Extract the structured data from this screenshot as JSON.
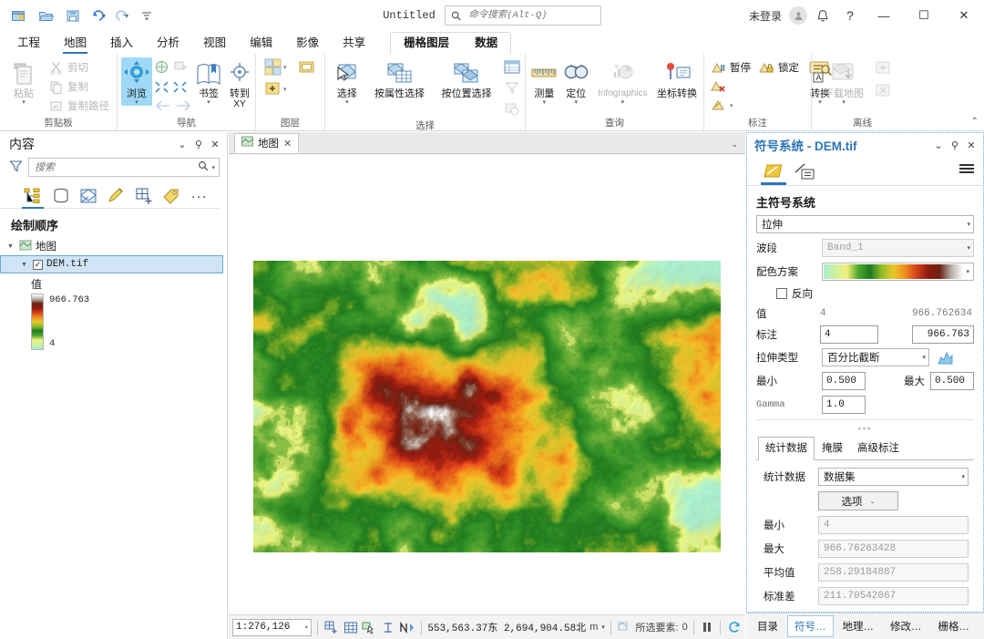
{
  "titlebar": {
    "quick_access": [
      "new-project-icon",
      "open-project-icon",
      "save-project-icon",
      "undo-icon",
      "redo-icon",
      "customize-qat-icon"
    ],
    "document_title": "Untitled",
    "search_placeholder": "命令搜索(Alt-Q)",
    "search_value": "",
    "sign_in": "未登录",
    "account_icon": "user-icon",
    "notification_icon": "bell-icon",
    "help_icon": "question-icon",
    "minimize": "—",
    "maximize": "☐",
    "close": "✕"
  },
  "ribbon": {
    "tabs": [
      {
        "label": "工程",
        "active": false
      },
      {
        "label": "地图",
        "active": true
      },
      {
        "label": "插入",
        "active": false
      },
      {
        "label": "分析",
        "active": false
      },
      {
        "label": "视图",
        "active": false
      },
      {
        "label": "编辑",
        "active": false
      },
      {
        "label": "影像",
        "active": false
      },
      {
        "label": "共享",
        "active": false
      }
    ],
    "contextual_tabs": [
      {
        "label": "栅格图层",
        "active": true
      },
      {
        "label": "数据",
        "active": false
      }
    ],
    "groups": [
      {
        "name": "剪贴板",
        "label": "剪贴板",
        "big": [
          {
            "label": "粘贴",
            "icon": "paste-icon",
            "dropdown": true,
            "disabled": false
          }
        ],
        "small": [
          {
            "label": "剪切",
            "icon": "cut-icon",
            "disabled": true
          },
          {
            "label": "复制",
            "icon": "copy-icon",
            "disabled": true
          },
          {
            "label": "复制路径",
            "icon": "copy-path-icon",
            "disabled": true
          }
        ]
      },
      {
        "name": "导航",
        "label": "导航",
        "big": [
          {
            "label": "浏览",
            "icon": "explore-icon",
            "dropdown": true,
            "active": true
          },
          {
            "label": "书签",
            "icon": "bookmarks-icon",
            "dropdown": true
          },
          {
            "label": "转到",
            "label2": "XY",
            "icon": "goto-xy-icon",
            "dropdown": false
          }
        ],
        "launcher": true
      },
      {
        "name": "图层",
        "label": "图层",
        "icons": [
          "basemap-icon",
          "add-data-icon",
          "add-layer-icon"
        ]
      },
      {
        "name": "选择",
        "label": "选择",
        "big": [
          {
            "label": "选择",
            "icon": "select-icon",
            "dropdown": true
          },
          {
            "label": "按属性选择",
            "icon": "select-by-attributes-icon",
            "dropdown": false
          },
          {
            "label": "按位置选择",
            "icon": "select-by-location-icon",
            "dropdown": false
          }
        ],
        "icons": [
          "attribute-table-icon",
          "select-layer-icon",
          "zoom-to-selection-icon"
        ],
        "launcher": true
      },
      {
        "name": "查询",
        "label": "查询",
        "big": [
          {
            "label": "测量",
            "icon": "measure-icon",
            "dropdown": true
          },
          {
            "label": "定位",
            "icon": "locate-icon",
            "dropdown": true
          },
          {
            "label": "Infographics",
            "icon": "infographics-icon",
            "dropdown": true,
            "disabled": true
          },
          {
            "label": "坐标转换",
            "icon": "coordinate-conversion-icon",
            "dropdown": false
          }
        ]
      },
      {
        "name": "标注",
        "label": "标注",
        "small": [
          {
            "label": "暂停",
            "icon": "pause-labeling-icon"
          },
          {
            "label": "锁定",
            "icon": "lock-labeling-icon"
          },
          {
            "label": "",
            "icon": "remove-label-icon"
          },
          {
            "label": "",
            "icon": "label-style-icon"
          }
        ],
        "big": [
          {
            "label": "转换",
            "icon": "convert-labels-icon",
            "dropdown": true
          }
        ],
        "launcher": true
      },
      {
        "name": "离线",
        "label": "离线",
        "big": [
          {
            "label": "下载地图",
            "icon": "download-map-icon",
            "dropdown": true,
            "disabled": true
          }
        ],
        "icons": [
          "sync-icon",
          "remove-offline-icon"
        ],
        "launcher": true
      }
    ],
    "collapse_icon": "chevron-up-icon"
  },
  "contents": {
    "title": "内容",
    "controls": [
      "chevron-down-icon",
      "pin-icon",
      "close-icon"
    ],
    "filter_icon": "filter-icon",
    "search_placeholder": "搜索",
    "search_value": "",
    "toolbar_icons": [
      "list-by-drawing-order-icon",
      "list-by-data-source-icon",
      "list-by-selection-icon",
      "list-by-editing-icon",
      "list-by-snapping-icon",
      "list-by-labeling-icon",
      "more-options-icon"
    ],
    "heading": "绘制顺序",
    "map_node": "地图",
    "layer_name": "DEM.tif",
    "layer_checked": true,
    "legend": {
      "title": "值",
      "high": "966.763",
      "low": "4"
    }
  },
  "map": {
    "tab_label": "地图",
    "tab_close": "✕",
    "tabstrip_caret": "chevron-down-icon"
  },
  "statusbar": {
    "scale": "1:276,126",
    "tool_icons": [
      "add-grid-icon",
      "grid-icon",
      "select-tool-icon",
      "measure-tool-icon",
      "north-icon"
    ],
    "coordinates": "553,563.37东  2,694,904.58北",
    "units": "m",
    "units_caret": "chevron-down-icon",
    "selected_label": "所选要素:",
    "selected_count": "0",
    "pause_icon": "pause-drawing-icon",
    "refresh_icon": "refresh-icon"
  },
  "symbology": {
    "title": "符号系统 - DEM.tif",
    "controls": [
      "chevron-down-icon",
      "pin-icon",
      "close-icon"
    ],
    "toolbar_icons": [
      "primary-symbology-icon",
      "vary-by-variable-icon"
    ],
    "menu_icon": "hamburger-menu-icon",
    "section_title": "主符号系统",
    "primary_symbology": {
      "label": "",
      "value": "拉伸"
    },
    "band": {
      "label": "波段",
      "value": "Band_1",
      "disabled": true
    },
    "color_scheme": {
      "label": "配色方案"
    },
    "invert": {
      "label": "反向",
      "checked": false
    },
    "value_row": {
      "label": "值",
      "min": "4",
      "max": "966.762634"
    },
    "label_row": {
      "label": "标注",
      "min": "4",
      "max": "966.763"
    },
    "stretch_type": {
      "label": "拉伸类型",
      "value": "百分比截断",
      "histogram_icon": "histogram-icon"
    },
    "min_max": {
      "min_label": "最小",
      "min_value": "0.500",
      "max_label": "最大",
      "max_value": "0.500"
    },
    "gamma": {
      "label": "Gamma",
      "value": "1.0"
    },
    "tabs": [
      {
        "label": "统计数据",
        "active": true
      },
      {
        "label": "掩膜",
        "active": false
      },
      {
        "label": "高级标注",
        "active": false
      }
    ],
    "stats": {
      "source_label": "统计数据",
      "source_value": "数据集",
      "options_label": "选项",
      "rows": [
        {
          "label": "最小",
          "value": "4"
        },
        {
          "label": "最大",
          "value": "966.76263428"
        },
        {
          "label": "平均值",
          "value": "258.29184887"
        },
        {
          "label": "标准差",
          "value": "211.70542067"
        }
      ]
    }
  },
  "pane_tabs": [
    {
      "label": "目录",
      "active": false
    },
    {
      "label": "符号…",
      "active": true
    },
    {
      "label": "地理…",
      "active": false
    },
    {
      "label": "修改…",
      "active": false
    },
    {
      "label": "栅格…",
      "active": false
    }
  ],
  "colors": {
    "accent": "#2e75b6",
    "highlight": "#cfe4f5",
    "active_tool": "#9ed9f7",
    "ramp_stops": [
      "#a8ecd0",
      "#cdf0a0",
      "#f2f07a",
      "#4ca62c",
      "#1f7a1f",
      "#8fbf2a",
      "#e8c92a",
      "#f08c1e",
      "#d4421a",
      "#8c1b10",
      "#6b2412",
      "#b7b0aa",
      "#ffffff"
    ]
  }
}
